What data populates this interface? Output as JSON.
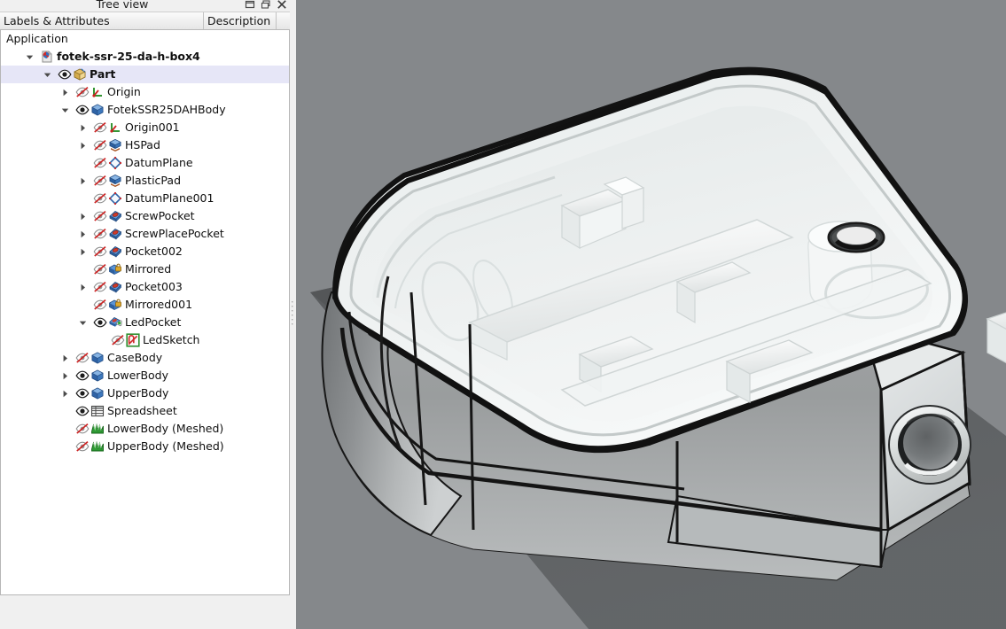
{
  "window": {
    "title": "Tree view",
    "controls": [
      {
        "name": "minimize",
        "icon": "minimize-icon"
      },
      {
        "name": "float",
        "icon": "float-icon"
      },
      {
        "name": "close",
        "icon": "close-icon"
      }
    ]
  },
  "tree_header": {
    "labels_column": "Labels & Attributes",
    "description_column": "Description"
  },
  "tree": {
    "rows": [
      {
        "label": "Application",
        "depth": 0,
        "arrow": "none",
        "visibility": "none",
        "icon": "none",
        "bold": false,
        "selected": false
      },
      {
        "label": "fotek-ssr-25-da-h-box4",
        "depth": 1,
        "arrow": "expanded",
        "visibility": "none",
        "icon": "document-icon",
        "bold": true,
        "selected": false
      },
      {
        "label": "Part",
        "depth": 2,
        "arrow": "expanded",
        "visibility": "visible",
        "icon": "part-icon",
        "bold": true,
        "selected": true
      },
      {
        "label": "Origin",
        "depth": 3,
        "arrow": "collapsed",
        "visibility": "hidden",
        "icon": "origin-icon",
        "bold": false,
        "selected": false
      },
      {
        "label": "FotekSSR25DAHBody",
        "depth": 3,
        "arrow": "expanded",
        "visibility": "visible",
        "icon": "body-icon",
        "bold": false,
        "selected": false
      },
      {
        "label": "Origin001",
        "depth": 4,
        "arrow": "collapsed",
        "visibility": "hidden",
        "icon": "origin-icon",
        "bold": false,
        "selected": false
      },
      {
        "label": "HSPad",
        "depth": 4,
        "arrow": "collapsed",
        "visibility": "hidden",
        "icon": "pad-icon",
        "bold": false,
        "selected": false
      },
      {
        "label": "DatumPlane",
        "depth": 4,
        "arrow": "none",
        "visibility": "hidden",
        "icon": "datumplane-icon",
        "bold": false,
        "selected": false
      },
      {
        "label": "PlasticPad",
        "depth": 4,
        "arrow": "collapsed",
        "visibility": "hidden",
        "icon": "pad-icon",
        "bold": false,
        "selected": false
      },
      {
        "label": "DatumPlane001",
        "depth": 4,
        "arrow": "none",
        "visibility": "hidden",
        "icon": "datumplane-icon",
        "bold": false,
        "selected": false
      },
      {
        "label": "ScrewPocket",
        "depth": 4,
        "arrow": "collapsed",
        "visibility": "hidden",
        "icon": "pocket-icon",
        "bold": false,
        "selected": false
      },
      {
        "label": "ScrewPlacePocket",
        "depth": 4,
        "arrow": "collapsed",
        "visibility": "hidden",
        "icon": "pocket-icon",
        "bold": false,
        "selected": false
      },
      {
        "label": "Pocket002",
        "depth": 4,
        "arrow": "collapsed",
        "visibility": "hidden",
        "icon": "pocket-icon",
        "bold": false,
        "selected": false
      },
      {
        "label": "Mirrored",
        "depth": 4,
        "arrow": "none",
        "visibility": "hidden",
        "icon": "mirrored-icon",
        "bold": false,
        "selected": false
      },
      {
        "label": "Pocket003",
        "depth": 4,
        "arrow": "collapsed",
        "visibility": "hidden",
        "icon": "pocket-icon",
        "bold": false,
        "selected": false
      },
      {
        "label": "Mirrored001",
        "depth": 4,
        "arrow": "none",
        "visibility": "hidden",
        "icon": "mirrored-icon",
        "bold": false,
        "selected": false
      },
      {
        "label": "LedPocket",
        "depth": 4,
        "arrow": "expanded",
        "visibility": "visible",
        "icon": "tip-pocket-icon",
        "bold": false,
        "selected": false
      },
      {
        "label": "LedSketch",
        "depth": 5,
        "arrow": "none",
        "visibility": "hidden",
        "icon": "sketch-icon",
        "bold": false,
        "selected": false
      },
      {
        "label": "CaseBody",
        "depth": 3,
        "arrow": "collapsed",
        "visibility": "hidden",
        "icon": "body-icon",
        "bold": false,
        "selected": false
      },
      {
        "label": "LowerBody",
        "depth": 3,
        "arrow": "collapsed",
        "visibility": "visible",
        "icon": "body-icon",
        "bold": false,
        "selected": false
      },
      {
        "label": "UpperBody",
        "depth": 3,
        "arrow": "collapsed",
        "visibility": "visible",
        "icon": "body-icon",
        "bold": false,
        "selected": false
      },
      {
        "label": "Spreadsheet",
        "depth": 3,
        "arrow": "none",
        "visibility": "visible",
        "icon": "spreadsheet-icon",
        "bold": false,
        "selected": false
      },
      {
        "label": "LowerBody (Meshed)",
        "depth": 3,
        "arrow": "none",
        "visibility": "hidden",
        "icon": "mesh-icon",
        "bold": false,
        "selected": false
      },
      {
        "label": "UpperBody (Meshed)",
        "depth": 3,
        "arrow": "none",
        "visibility": "hidden",
        "icon": "mesh-icon",
        "bold": false,
        "selected": false
      }
    ]
  },
  "viewport": {
    "name": "3d-viewport",
    "model_description": "Isometric view of a translucent white plastic enclosure (SSR relay box) with internal ribs, screw bosses and a circular port on the right face",
    "background_color": "#85888b",
    "shadow_color": "#545658",
    "model_body_color": "#eef1f1",
    "model_edge_color": "#161616"
  },
  "colors": {
    "panel_bg": "#f0f0f0",
    "tree_bg": "#ffffff",
    "selection": "#e6e6f7",
    "header_text": "#141414",
    "icon_blue": "#2d5fa8",
    "icon_green": "#3f9f3f",
    "hidden_red": "#cc2222"
  }
}
